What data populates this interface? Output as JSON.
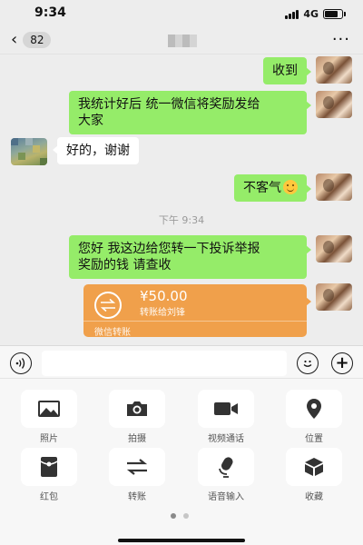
{
  "status_bar": {
    "time": "9:34",
    "network": "4G",
    "battery_percent": 75
  },
  "nav": {
    "back_chevron": "‹",
    "unread_count": "82",
    "title_blurred": true,
    "more_label": "···"
  },
  "messages": [
    {
      "side": "self",
      "text": "收到"
    },
    {
      "side": "self",
      "text_lines": [
        "我统计好后 统一微信将奖励发给",
        "大家"
      ]
    },
    {
      "side": "other",
      "text": "好的，谢谢"
    },
    {
      "side": "self",
      "text": "不客气",
      "emoji": "smile-emoji"
    },
    {
      "side": "self",
      "text_lines": [
        "您好 我这边给您转一下投诉举报",
        "奖励的钱 请查收"
      ]
    }
  ],
  "timestamp": "下午 9:34",
  "transfer": {
    "amount": "¥50.00",
    "description": "转账给刘锋",
    "footer": "微信转账",
    "color": "#f0a04b"
  },
  "input_bar": {
    "voice_icon": "voice-icon",
    "emoji_icon": "emoji-icon",
    "plus_icon": "plus-icon",
    "plus_label": "+"
  },
  "panel": {
    "tools": [
      {
        "label": "照片",
        "icon": "photo-icon"
      },
      {
        "label": "拍摄",
        "icon": "camera-icon"
      },
      {
        "label": "视频通话",
        "icon": "video-call-icon"
      },
      {
        "label": "位置",
        "icon": "location-icon"
      },
      {
        "label": "红包",
        "icon": "red-packet-icon"
      },
      {
        "label": "转账",
        "icon": "transfer-icon"
      },
      {
        "label": "语音输入",
        "icon": "microphone-icon"
      },
      {
        "label": "收藏",
        "icon": "favorites-icon"
      }
    ],
    "page_count": 2,
    "current_page": 1
  },
  "colors": {
    "background": "#ededed",
    "self_bubble": "#95ec69",
    "other_bubble": "#ffffff",
    "transfer": "#f0a04b"
  }
}
